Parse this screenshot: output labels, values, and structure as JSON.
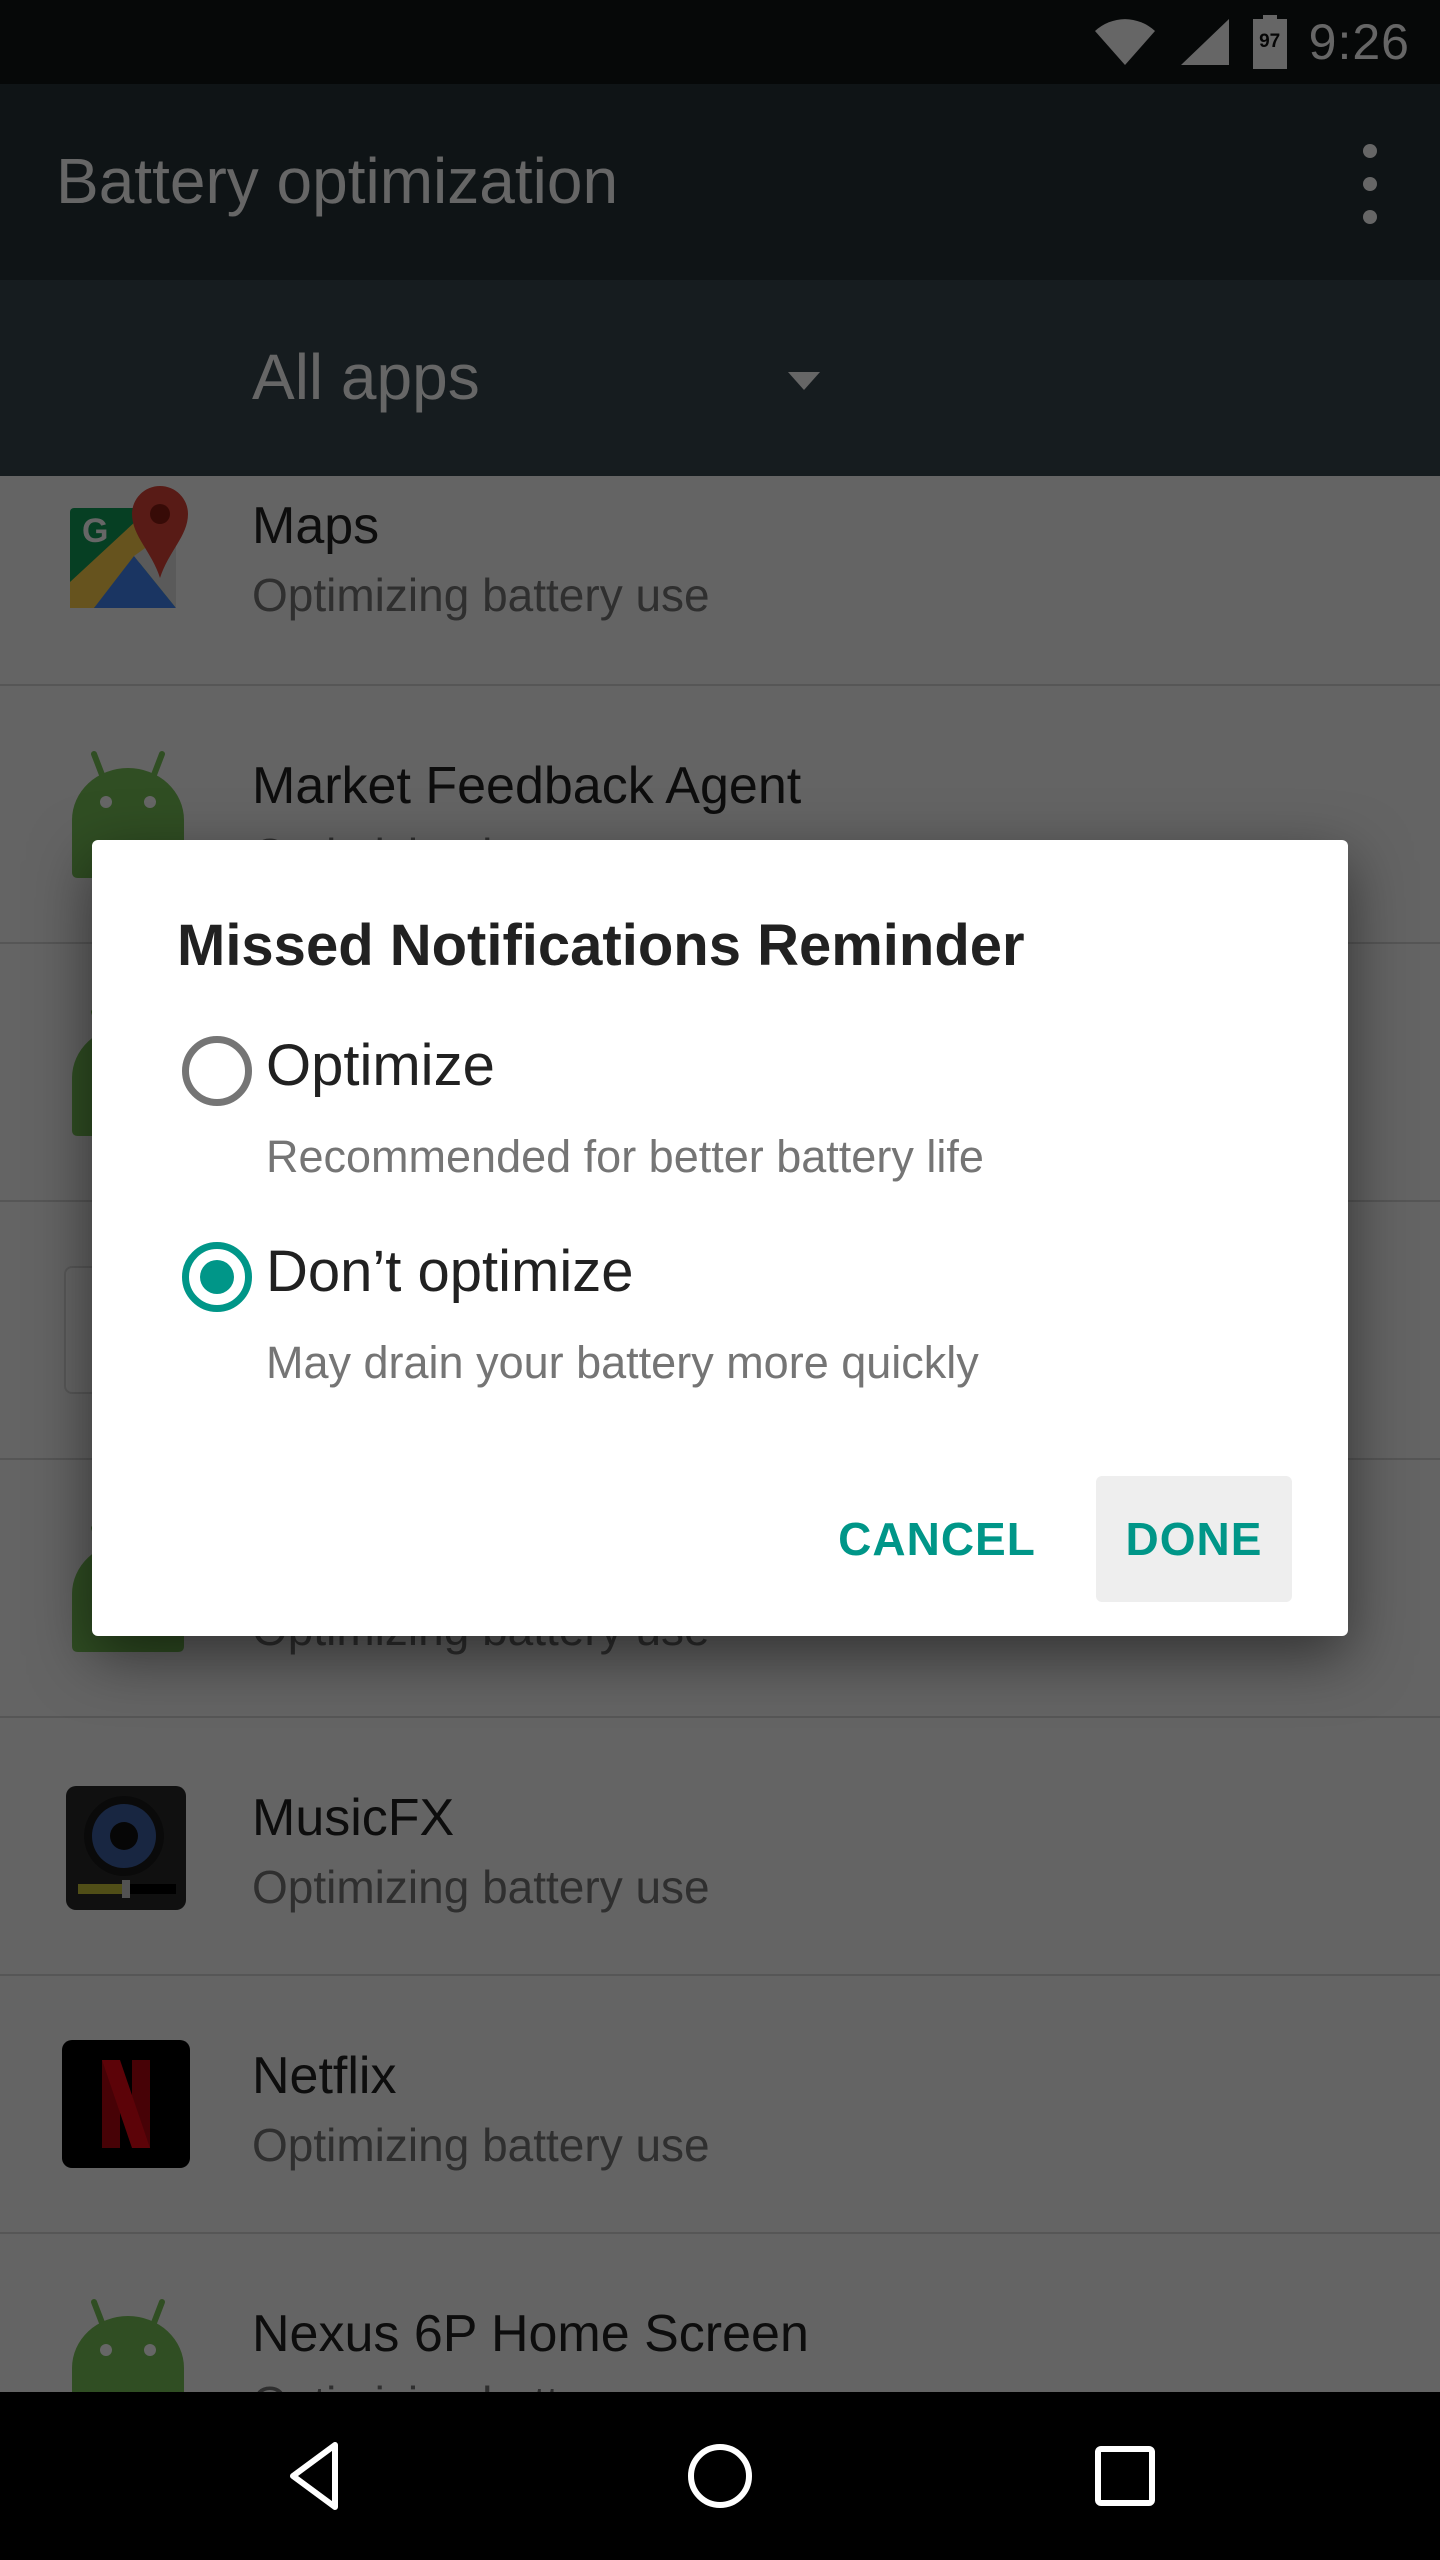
{
  "status_bar": {
    "time": "9:26",
    "battery_level": "97",
    "icons": [
      "wifi-icon",
      "cell-signal-icon",
      "battery-icon"
    ]
  },
  "app_bar": {
    "title": "Battery optimization",
    "overflow_icon": "more-vert-icon"
  },
  "filter": {
    "selected": "All apps",
    "icon": "dropdown-arrow-icon"
  },
  "app_list": [
    {
      "name": "Maps",
      "status": "Optimizing battery use",
      "icon": "google-maps-icon"
    },
    {
      "name": "Market Feedback Agent",
      "status": "Optimizing battery use",
      "icon": "android-icon"
    },
    {
      "name": "",
      "status": "",
      "icon": "android-icon"
    },
    {
      "name": "",
      "status": "",
      "icon": "generic-app-icon"
    },
    {
      "name": "",
      "status": "Optimizing battery use",
      "icon": "android-icon"
    },
    {
      "name": "MusicFX",
      "status": "Optimizing battery use",
      "icon": "musicfx-speaker-icon"
    },
    {
      "name": "Netflix",
      "status": "Optimizing battery use",
      "icon": "netflix-icon"
    },
    {
      "name": "Nexus 6P Home Screen",
      "status": "Optimizing battery use",
      "icon": "android-icon"
    }
  ],
  "dialog": {
    "title": "Missed Notifications Reminder",
    "options": [
      {
        "label": "Optimize",
        "summary": "Recommended for better battery life",
        "checked": false
      },
      {
        "label": "Don’t optimize",
        "summary": "May drain your battery more quickly",
        "checked": true
      }
    ],
    "cancel_label": "CANCEL",
    "done_label": "DONE"
  },
  "nav_bar": {
    "buttons": [
      "back-icon",
      "home-icon",
      "recents-icon"
    ]
  },
  "colors": {
    "accent": "#009688",
    "app_bar": "#263238",
    "filter_bar": "#37474f",
    "status_bar": "#111416"
  }
}
